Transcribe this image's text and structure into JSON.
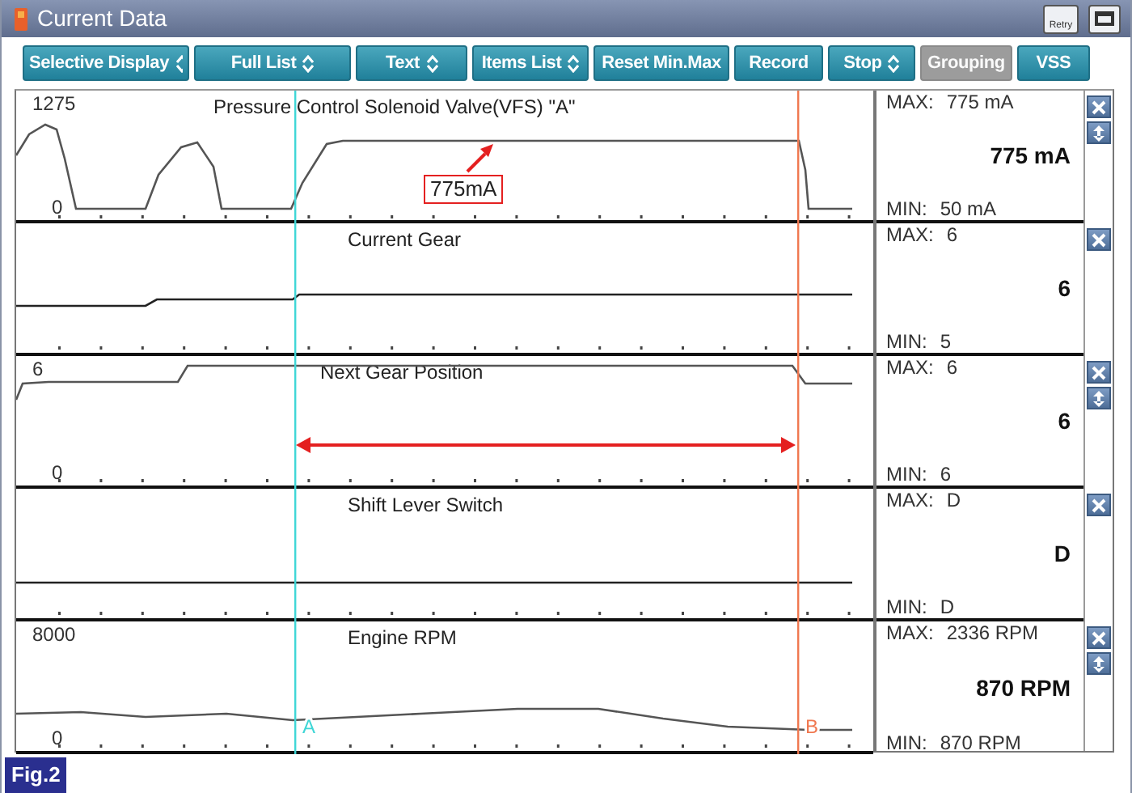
{
  "window": {
    "title": "Current Data",
    "retry_label": "Retry"
  },
  "toolbar": [
    {
      "label": "Selective Display",
      "dropdown": true,
      "disabled": false
    },
    {
      "label": "Full List",
      "dropdown": true,
      "disabled": false
    },
    {
      "label": "Text",
      "dropdown": true,
      "disabled": false
    },
    {
      "label": "Items List",
      "dropdown": true,
      "disabled": false
    },
    {
      "label": "Reset Min.Max",
      "dropdown": false,
      "disabled": false
    },
    {
      "label": "Record",
      "dropdown": false,
      "disabled": false
    },
    {
      "label": "Stop",
      "dropdown": true,
      "disabled": false
    },
    {
      "label": "Grouping",
      "dropdown": false,
      "disabled": true
    },
    {
      "label": "VSS",
      "dropdown": false,
      "disabled": false
    }
  ],
  "signals": [
    {
      "name": "Pressure Control Solenoid Valve(VFS) \"A\"",
      "scale_max": "1275",
      "scale_min": "0",
      "max_label": "MAX:",
      "max": "775 mA",
      "value": "775 mA",
      "min_label": "MIN:",
      "min": "50 mA",
      "resizable": true
    },
    {
      "name": "Current Gear",
      "max_label": "MAX:",
      "max": "6",
      "value": "6",
      "min_label": "MIN:",
      "min": "5",
      "resizable": false
    },
    {
      "name": "Next Gear Position",
      "scale_max": "6",
      "scale_min": "0",
      "max_label": "MAX:",
      "max": "6",
      "value": "6",
      "min_label": "MIN:",
      "min": "6",
      "resizable": true
    },
    {
      "name": "Shift Lever Switch",
      "max_label": "MAX:",
      "max": "D",
      "value": "D",
      "min_label": "MIN:",
      "min": "D",
      "resizable": false
    },
    {
      "name": "Engine RPM",
      "scale_max": "8000",
      "scale_min": "0",
      "max_label": "MAX:",
      "max": "2336 RPM",
      "value": "870 RPM",
      "min_label": "MIN:",
      "min": "870 RPM",
      "resizable": true
    }
  ],
  "cursors": [
    {
      "label": "A"
    },
    {
      "label": "B"
    }
  ],
  "annotation": {
    "label": "775mA"
  },
  "figure_label": "Fig.2"
}
